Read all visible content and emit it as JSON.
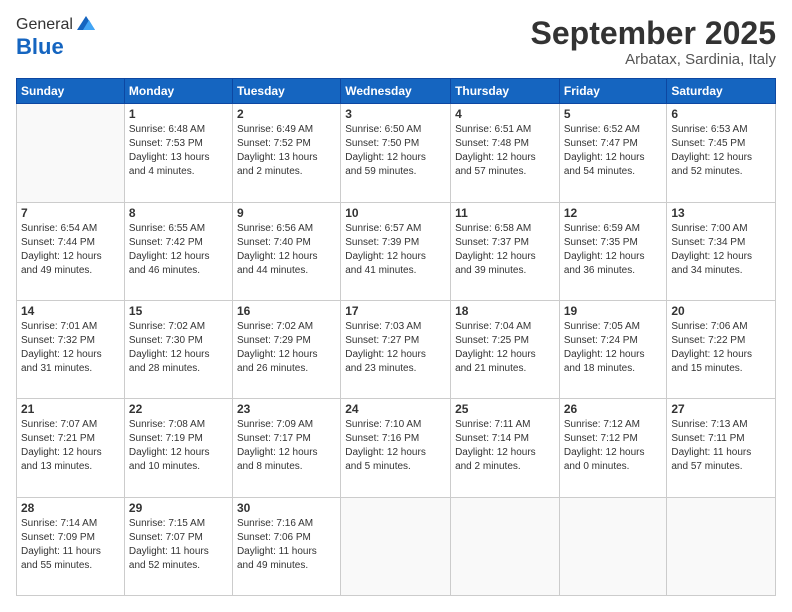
{
  "logo": {
    "general": "General",
    "blue": "Blue"
  },
  "header": {
    "month": "September 2025",
    "location": "Arbatax, Sardinia, Italy"
  },
  "weekdays": [
    "Sunday",
    "Monday",
    "Tuesday",
    "Wednesday",
    "Thursday",
    "Friday",
    "Saturday"
  ],
  "weeks": [
    [
      {
        "day": "",
        "info": ""
      },
      {
        "day": "1",
        "info": "Sunrise: 6:48 AM\nSunset: 7:53 PM\nDaylight: 13 hours\nand 4 minutes."
      },
      {
        "day": "2",
        "info": "Sunrise: 6:49 AM\nSunset: 7:52 PM\nDaylight: 13 hours\nand 2 minutes."
      },
      {
        "day": "3",
        "info": "Sunrise: 6:50 AM\nSunset: 7:50 PM\nDaylight: 12 hours\nand 59 minutes."
      },
      {
        "day": "4",
        "info": "Sunrise: 6:51 AM\nSunset: 7:48 PM\nDaylight: 12 hours\nand 57 minutes."
      },
      {
        "day": "5",
        "info": "Sunrise: 6:52 AM\nSunset: 7:47 PM\nDaylight: 12 hours\nand 54 minutes."
      },
      {
        "day": "6",
        "info": "Sunrise: 6:53 AM\nSunset: 7:45 PM\nDaylight: 12 hours\nand 52 minutes."
      }
    ],
    [
      {
        "day": "7",
        "info": "Sunrise: 6:54 AM\nSunset: 7:44 PM\nDaylight: 12 hours\nand 49 minutes."
      },
      {
        "day": "8",
        "info": "Sunrise: 6:55 AM\nSunset: 7:42 PM\nDaylight: 12 hours\nand 46 minutes."
      },
      {
        "day": "9",
        "info": "Sunrise: 6:56 AM\nSunset: 7:40 PM\nDaylight: 12 hours\nand 44 minutes."
      },
      {
        "day": "10",
        "info": "Sunrise: 6:57 AM\nSunset: 7:39 PM\nDaylight: 12 hours\nand 41 minutes."
      },
      {
        "day": "11",
        "info": "Sunrise: 6:58 AM\nSunset: 7:37 PM\nDaylight: 12 hours\nand 39 minutes."
      },
      {
        "day": "12",
        "info": "Sunrise: 6:59 AM\nSunset: 7:35 PM\nDaylight: 12 hours\nand 36 minutes."
      },
      {
        "day": "13",
        "info": "Sunrise: 7:00 AM\nSunset: 7:34 PM\nDaylight: 12 hours\nand 34 minutes."
      }
    ],
    [
      {
        "day": "14",
        "info": "Sunrise: 7:01 AM\nSunset: 7:32 PM\nDaylight: 12 hours\nand 31 minutes."
      },
      {
        "day": "15",
        "info": "Sunrise: 7:02 AM\nSunset: 7:30 PM\nDaylight: 12 hours\nand 28 minutes."
      },
      {
        "day": "16",
        "info": "Sunrise: 7:02 AM\nSunset: 7:29 PM\nDaylight: 12 hours\nand 26 minutes."
      },
      {
        "day": "17",
        "info": "Sunrise: 7:03 AM\nSunset: 7:27 PM\nDaylight: 12 hours\nand 23 minutes."
      },
      {
        "day": "18",
        "info": "Sunrise: 7:04 AM\nSunset: 7:25 PM\nDaylight: 12 hours\nand 21 minutes."
      },
      {
        "day": "19",
        "info": "Sunrise: 7:05 AM\nSunset: 7:24 PM\nDaylight: 12 hours\nand 18 minutes."
      },
      {
        "day": "20",
        "info": "Sunrise: 7:06 AM\nSunset: 7:22 PM\nDaylight: 12 hours\nand 15 minutes."
      }
    ],
    [
      {
        "day": "21",
        "info": "Sunrise: 7:07 AM\nSunset: 7:21 PM\nDaylight: 12 hours\nand 13 minutes."
      },
      {
        "day": "22",
        "info": "Sunrise: 7:08 AM\nSunset: 7:19 PM\nDaylight: 12 hours\nand 10 minutes."
      },
      {
        "day": "23",
        "info": "Sunrise: 7:09 AM\nSunset: 7:17 PM\nDaylight: 12 hours\nand 8 minutes."
      },
      {
        "day": "24",
        "info": "Sunrise: 7:10 AM\nSunset: 7:16 PM\nDaylight: 12 hours\nand 5 minutes."
      },
      {
        "day": "25",
        "info": "Sunrise: 7:11 AM\nSunset: 7:14 PM\nDaylight: 12 hours\nand 2 minutes."
      },
      {
        "day": "26",
        "info": "Sunrise: 7:12 AM\nSunset: 7:12 PM\nDaylight: 12 hours\nand 0 minutes."
      },
      {
        "day": "27",
        "info": "Sunrise: 7:13 AM\nSunset: 7:11 PM\nDaylight: 11 hours\nand 57 minutes."
      }
    ],
    [
      {
        "day": "28",
        "info": "Sunrise: 7:14 AM\nSunset: 7:09 PM\nDaylight: 11 hours\nand 55 minutes."
      },
      {
        "day": "29",
        "info": "Sunrise: 7:15 AM\nSunset: 7:07 PM\nDaylight: 11 hours\nand 52 minutes."
      },
      {
        "day": "30",
        "info": "Sunrise: 7:16 AM\nSunset: 7:06 PM\nDaylight: 11 hours\nand 49 minutes."
      },
      {
        "day": "",
        "info": ""
      },
      {
        "day": "",
        "info": ""
      },
      {
        "day": "",
        "info": ""
      },
      {
        "day": "",
        "info": ""
      }
    ]
  ]
}
